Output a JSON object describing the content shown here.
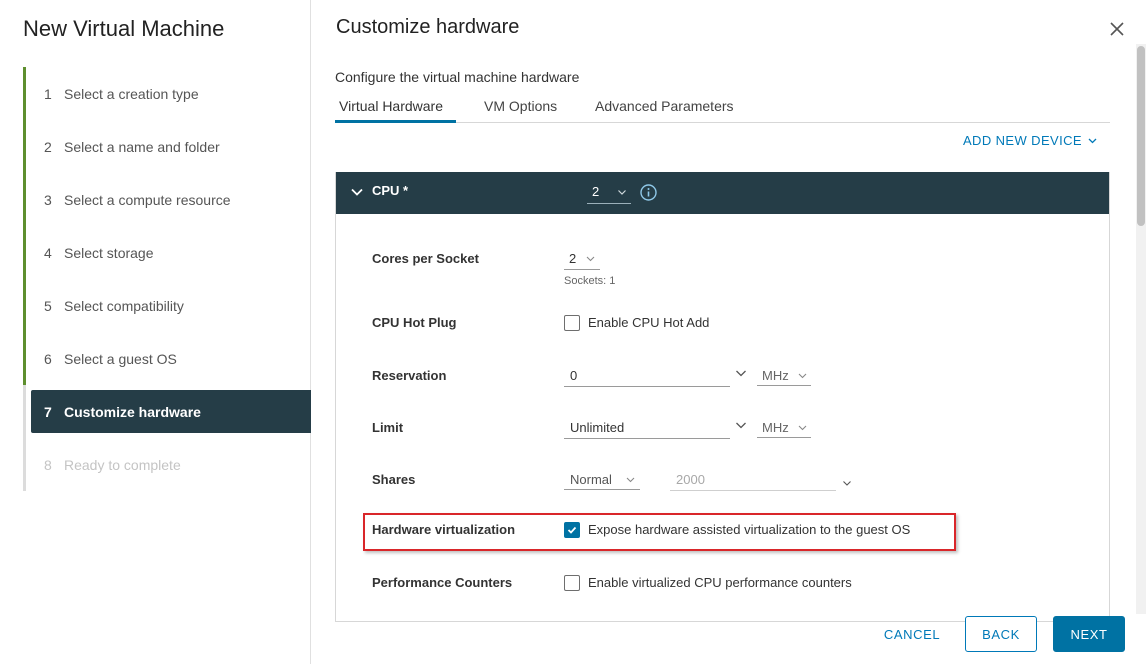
{
  "wizard": {
    "title": "New Virtual Machine",
    "steps": [
      {
        "num": "1",
        "label": "Select a creation type"
      },
      {
        "num": "2",
        "label": "Select a name and folder"
      },
      {
        "num": "3",
        "label": "Select a compute resource"
      },
      {
        "num": "4",
        "label": "Select storage"
      },
      {
        "num": "5",
        "label": "Select compatibility"
      },
      {
        "num": "6",
        "label": "Select a guest OS"
      },
      {
        "num": "7",
        "label": "Customize hardware"
      },
      {
        "num": "8",
        "label": "Ready to complete"
      }
    ],
    "active_step": 7
  },
  "main": {
    "title": "Customize hardware",
    "subtitle": "Configure the virtual machine hardware",
    "tabs": [
      "Virtual Hardware",
      "VM Options",
      "Advanced Parameters"
    ],
    "active_tab": "Virtual Hardware",
    "add_device_label": "ADD NEW DEVICE"
  },
  "cpu": {
    "label": "CPU *",
    "value": "2",
    "cores_per_socket_label": "Cores per Socket",
    "cores_per_socket_value": "2",
    "sockets_text": "Sockets: 1",
    "hot_plug_label": "CPU Hot Plug",
    "hot_plug_option": "Enable CPU Hot Add",
    "hot_plug_checked": false,
    "reservation_label": "Reservation",
    "reservation_value": "0",
    "reservation_unit": "MHz",
    "limit_label": "Limit",
    "limit_value": "Unlimited",
    "limit_unit": "MHz",
    "shares_label": "Shares",
    "shares_value": "Normal",
    "shares_number_placeholder": "2000",
    "hw_virt_label": "Hardware virtualization",
    "hw_virt_option": "Expose hardware assisted virtualization to the guest OS",
    "hw_virt_checked": true,
    "perf_counters_label": "Performance Counters",
    "perf_counters_option": "Enable virtualized CPU performance counters",
    "perf_counters_checked": false
  },
  "footer": {
    "cancel": "CANCEL",
    "back": "BACK",
    "next": "NEXT"
  },
  "colors": {
    "accent": "#0072a3",
    "header_dark": "#253d47",
    "progress_green": "#5e8f2e",
    "highlight_red": "#d9262a"
  }
}
